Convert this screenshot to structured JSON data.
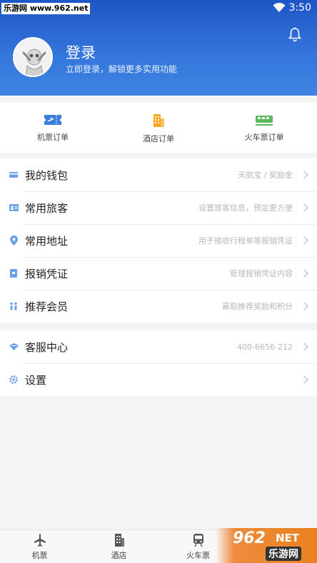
{
  "status_bar": {
    "watermark": "乐游网 www.962.net",
    "time": "3:50"
  },
  "profile": {
    "title": "登录",
    "subtitle": "立即登录，解锁更多实用功能"
  },
  "orders": [
    {
      "label": "机票订单",
      "icon": "flight-ticket-icon"
    },
    {
      "label": "酒店订单",
      "icon": "hotel-icon"
    },
    {
      "label": "火车票订单",
      "icon": "train-icon"
    }
  ],
  "menu": [
    {
      "label": "我的钱包",
      "hint": "天航宝 / 奖励金",
      "icon": "wallet-icon"
    },
    {
      "label": "常用旅客",
      "hint": "设置旅客信息，预定更方便",
      "icon": "id-card-icon"
    },
    {
      "label": "常用地址",
      "hint": "用于接收行程单等报销凭证",
      "icon": "location-pin-icon"
    },
    {
      "label": "报销凭证",
      "hint": "管理报销凭证内容",
      "icon": "receipt-icon"
    },
    {
      "label": "推荐会员",
      "hint": "赢取推荐奖励和积分",
      "icon": "referral-icon"
    }
  ],
  "menu2": [
    {
      "label": "客服中心",
      "hint": "400-6656-212",
      "icon": "customer-service-icon"
    },
    {
      "label": "设置",
      "hint": "",
      "icon": "settings-icon"
    }
  ],
  "tabs": [
    {
      "label": "机票",
      "icon": "airplane-icon"
    },
    {
      "label": "酒店",
      "icon": "building-icon"
    },
    {
      "label": "火车票",
      "icon": "train-icon"
    },
    {
      "label": "",
      "icon": ""
    }
  ],
  "watermark": {
    "brand": "962",
    "suffix": "NET",
    "cn": "乐游网"
  },
  "colors": {
    "header_start": "#1f56c6",
    "header_end": "#3f84e3",
    "accent_blue": "#3a7ee0",
    "hotel_orange": "#f5a623",
    "train_green": "#5cb85c"
  }
}
